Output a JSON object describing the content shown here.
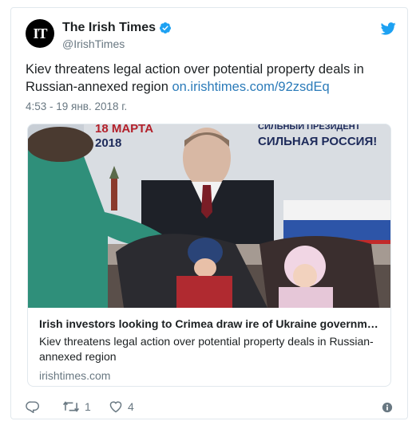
{
  "account": {
    "avatar_text": "IT",
    "display_name": "The Irish Times",
    "handle": "@IrishTimes",
    "icons": {
      "verified": "verified-badge-icon",
      "platform": "twitter-bird-icon"
    }
  },
  "tweet": {
    "text": "Kiev threatens legal action over potential property deals in Russian-annexed region",
    "link": "on.irishtimes.com/92zsdEq",
    "timestamp": "4:53 - 19 янв. 2018 г."
  },
  "card": {
    "image_text": {
      "date_line1": "18 МАРТА",
      "date_line2": "2018",
      "slogan_line1": "СИЛЬНЫЙ ПРЕЗИДЕНТ",
      "slogan_line2": "СИЛЬНАЯ РОССИЯ!"
    },
    "title": "Irish investors looking to Crimea draw ire of Ukraine government",
    "description": "Kiev threatens legal action over potential property deals in Russian-annexed region",
    "domain": "irishtimes.com"
  },
  "actions": {
    "reply": {
      "icon": "reply-icon",
      "count": ""
    },
    "retweet": {
      "icon": "retweet-icon",
      "count": "1"
    },
    "like": {
      "icon": "heart-icon",
      "count": "4"
    },
    "info": {
      "icon": "info-icon"
    }
  },
  "colors": {
    "link": "#2b7bb9",
    "twitter_blue": "#1da1f2",
    "secondary_text": "#697882",
    "border": "#e1e8ed"
  }
}
